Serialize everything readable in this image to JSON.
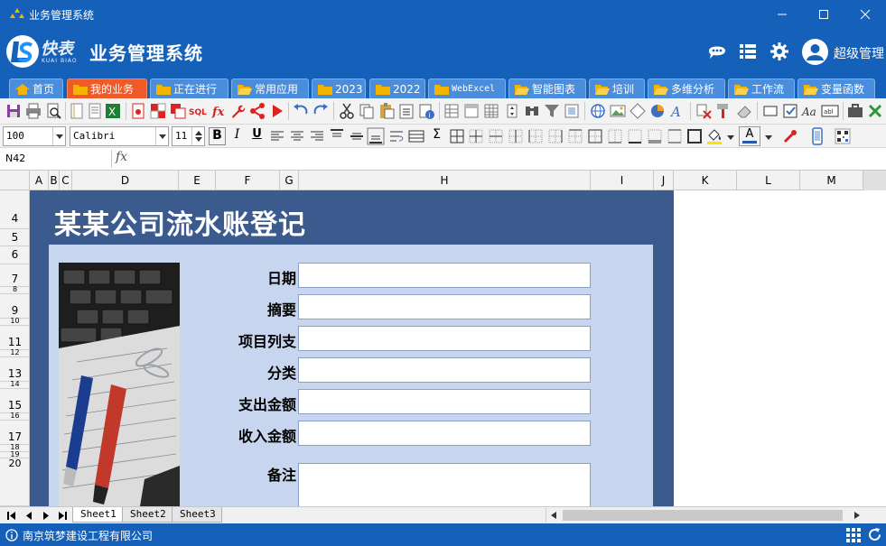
{
  "window": {
    "title": "业务管理系统"
  },
  "header": {
    "app_title": "业务管理系统",
    "logo_text": "快表",
    "logo_sub": "KUAI BIAO",
    "username": "超级管理"
  },
  "tabs": [
    {
      "label": "首页",
      "icon": "home-icon"
    },
    {
      "label": "我的业务",
      "icon": "folder-icon",
      "active": true
    },
    {
      "label": "正在进行",
      "icon": "folder-icon"
    },
    {
      "label": "常用应用",
      "icon": "folder-open-icon"
    },
    {
      "label": "2023",
      "icon": "folder-icon"
    },
    {
      "label": "2022",
      "icon": "folder-icon"
    },
    {
      "label": "WebExcel",
      "icon": "folder-icon"
    },
    {
      "label": "智能图表",
      "icon": "folder-open-icon"
    },
    {
      "label": "培训",
      "icon": "folder-open-icon"
    },
    {
      "label": "多维分析",
      "icon": "folder-open-icon"
    },
    {
      "label": "工作流",
      "icon": "folder-open-icon"
    },
    {
      "label": "变量函数",
      "icon": "folder-open-icon"
    }
  ],
  "format_bar": {
    "zoom": "100",
    "font": "Calibri",
    "font_size": "11",
    "bold": "B",
    "italic": "I",
    "underline": "U",
    "sum": "Σ",
    "font_color": "A"
  },
  "formula_bar": {
    "cell_ref": "N42",
    "fx": "fx",
    "formula": ""
  },
  "columns": [
    "A",
    "B",
    "C",
    "D",
    "E",
    "F",
    "G",
    "H",
    "I",
    "J",
    "K",
    "L",
    "M"
  ],
  "rows": [
    "4",
    "5",
    "6",
    "7",
    "8",
    "9",
    "10",
    "11",
    "12",
    "13",
    "14",
    "15",
    "16",
    "17",
    "18",
    "19",
    "20"
  ],
  "form": {
    "title": "某某公司流水账登记",
    "fields": [
      {
        "label": "日期",
        "value": ""
      },
      {
        "label": "摘要",
        "value": ""
      },
      {
        "label": "项目列支",
        "value": ""
      },
      {
        "label": "分类",
        "value": ""
      },
      {
        "label": "支出金额",
        "value": ""
      },
      {
        "label": "收入金额",
        "value": ""
      }
    ],
    "notes_label": "备注",
    "notes_value": ""
  },
  "sheets": [
    {
      "label": "Sheet1",
      "active": true
    },
    {
      "label": "Sheet2"
    },
    {
      "label": "Sheet3"
    }
  ],
  "status": {
    "company": "南京筑梦建设工程有限公司"
  },
  "colors": {
    "brand": "#1560b9",
    "active_tab": "#f05a28",
    "form_banner": "#3b5a8e",
    "form_panel": "#c7d6ee"
  }
}
